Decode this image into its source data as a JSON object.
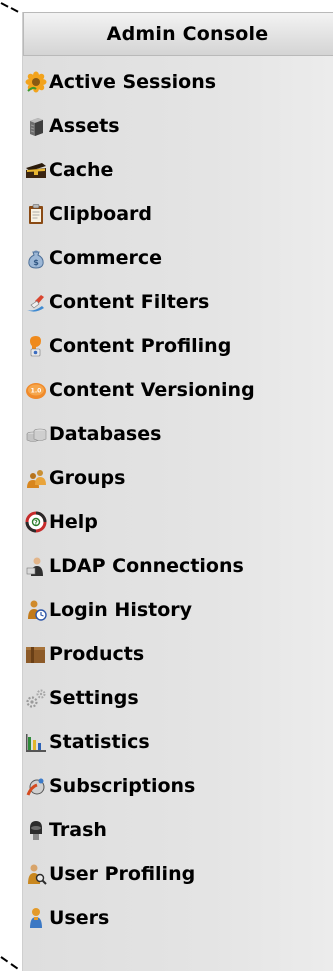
{
  "panel": {
    "title": "Admin Console"
  },
  "menu": {
    "items": [
      {
        "label": "Active Sessions",
        "icon": "sunflower-icon"
      },
      {
        "label": "Assets",
        "icon": "server-icon"
      },
      {
        "label": "Cache",
        "icon": "treasure-chest-icon"
      },
      {
        "label": "Clipboard",
        "icon": "clipboard-icon"
      },
      {
        "label": "Commerce",
        "icon": "money-bag-icon"
      },
      {
        "label": "Content Filters",
        "icon": "funnel-icon"
      },
      {
        "label": "Content Profiling",
        "icon": "person-profile-icon"
      },
      {
        "label": "Content Versioning",
        "icon": "version-badge-icon"
      },
      {
        "label": "Databases",
        "icon": "database-icon"
      },
      {
        "label": "Groups",
        "icon": "group-icon"
      },
      {
        "label": "Help",
        "icon": "lifebuoy-icon"
      },
      {
        "label": "LDAP Connections",
        "icon": "ldap-user-icon"
      },
      {
        "label": "Login History",
        "icon": "login-history-icon"
      },
      {
        "label": "Products",
        "icon": "box-icon"
      },
      {
        "label": "Settings",
        "icon": "gears-icon"
      },
      {
        "label": "Statistics",
        "icon": "bar-chart-icon"
      },
      {
        "label": "Subscriptions",
        "icon": "subscriptions-icon"
      },
      {
        "label": "Trash",
        "icon": "trash-icon"
      },
      {
        "label": "User Profiling",
        "icon": "user-search-icon"
      },
      {
        "label": "Users",
        "icon": "user-icon"
      }
    ]
  }
}
